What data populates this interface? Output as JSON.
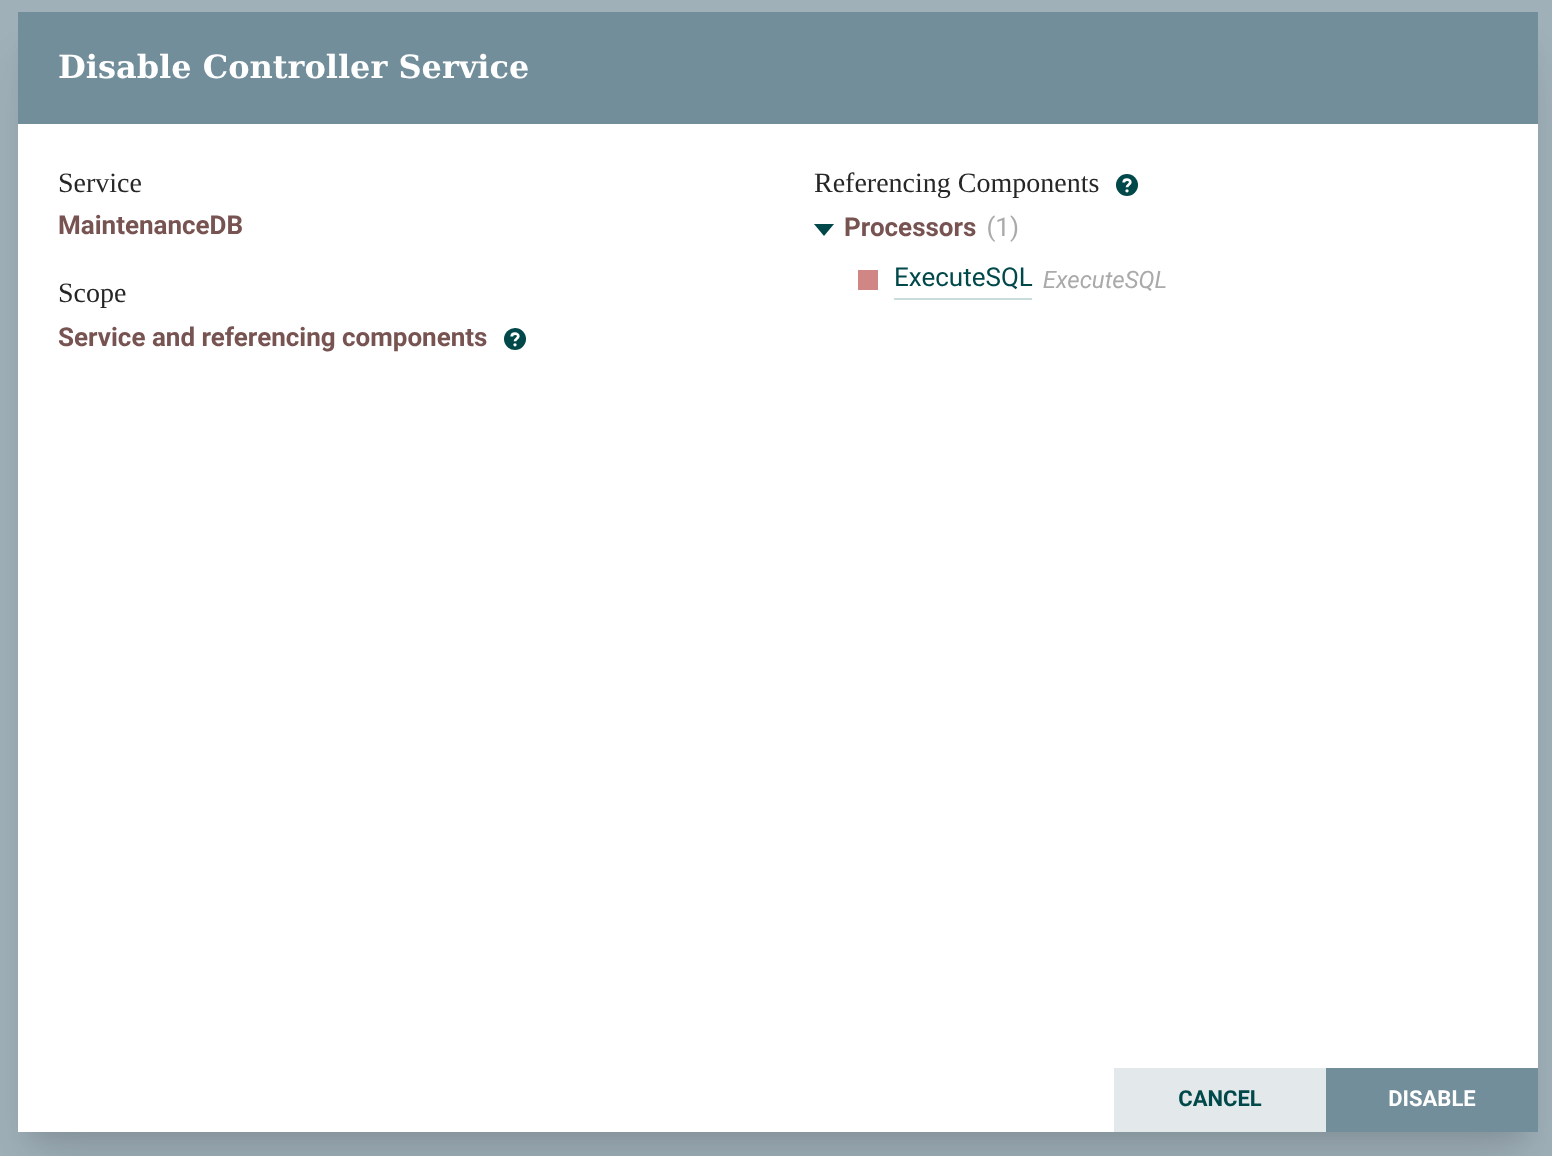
{
  "dialog": {
    "title": "Disable Controller Service",
    "service": {
      "label": "Service",
      "value": "MaintenanceDB"
    },
    "scope": {
      "label": "Scope",
      "value": "Service and referencing components"
    },
    "referencing": {
      "label": "Referencing Components",
      "groups": [
        {
          "name": "Processors",
          "count": "(1)",
          "expanded": true,
          "items": [
            {
              "name": "ExecuteSQL",
              "type": "ExecuteSQL",
              "color": "#d18686"
            }
          ]
        }
      ]
    },
    "buttons": [
      {
        "label": "CANCEL",
        "kind": "secondary"
      },
      {
        "label": "DISABLE",
        "kind": "primary"
      }
    ]
  }
}
